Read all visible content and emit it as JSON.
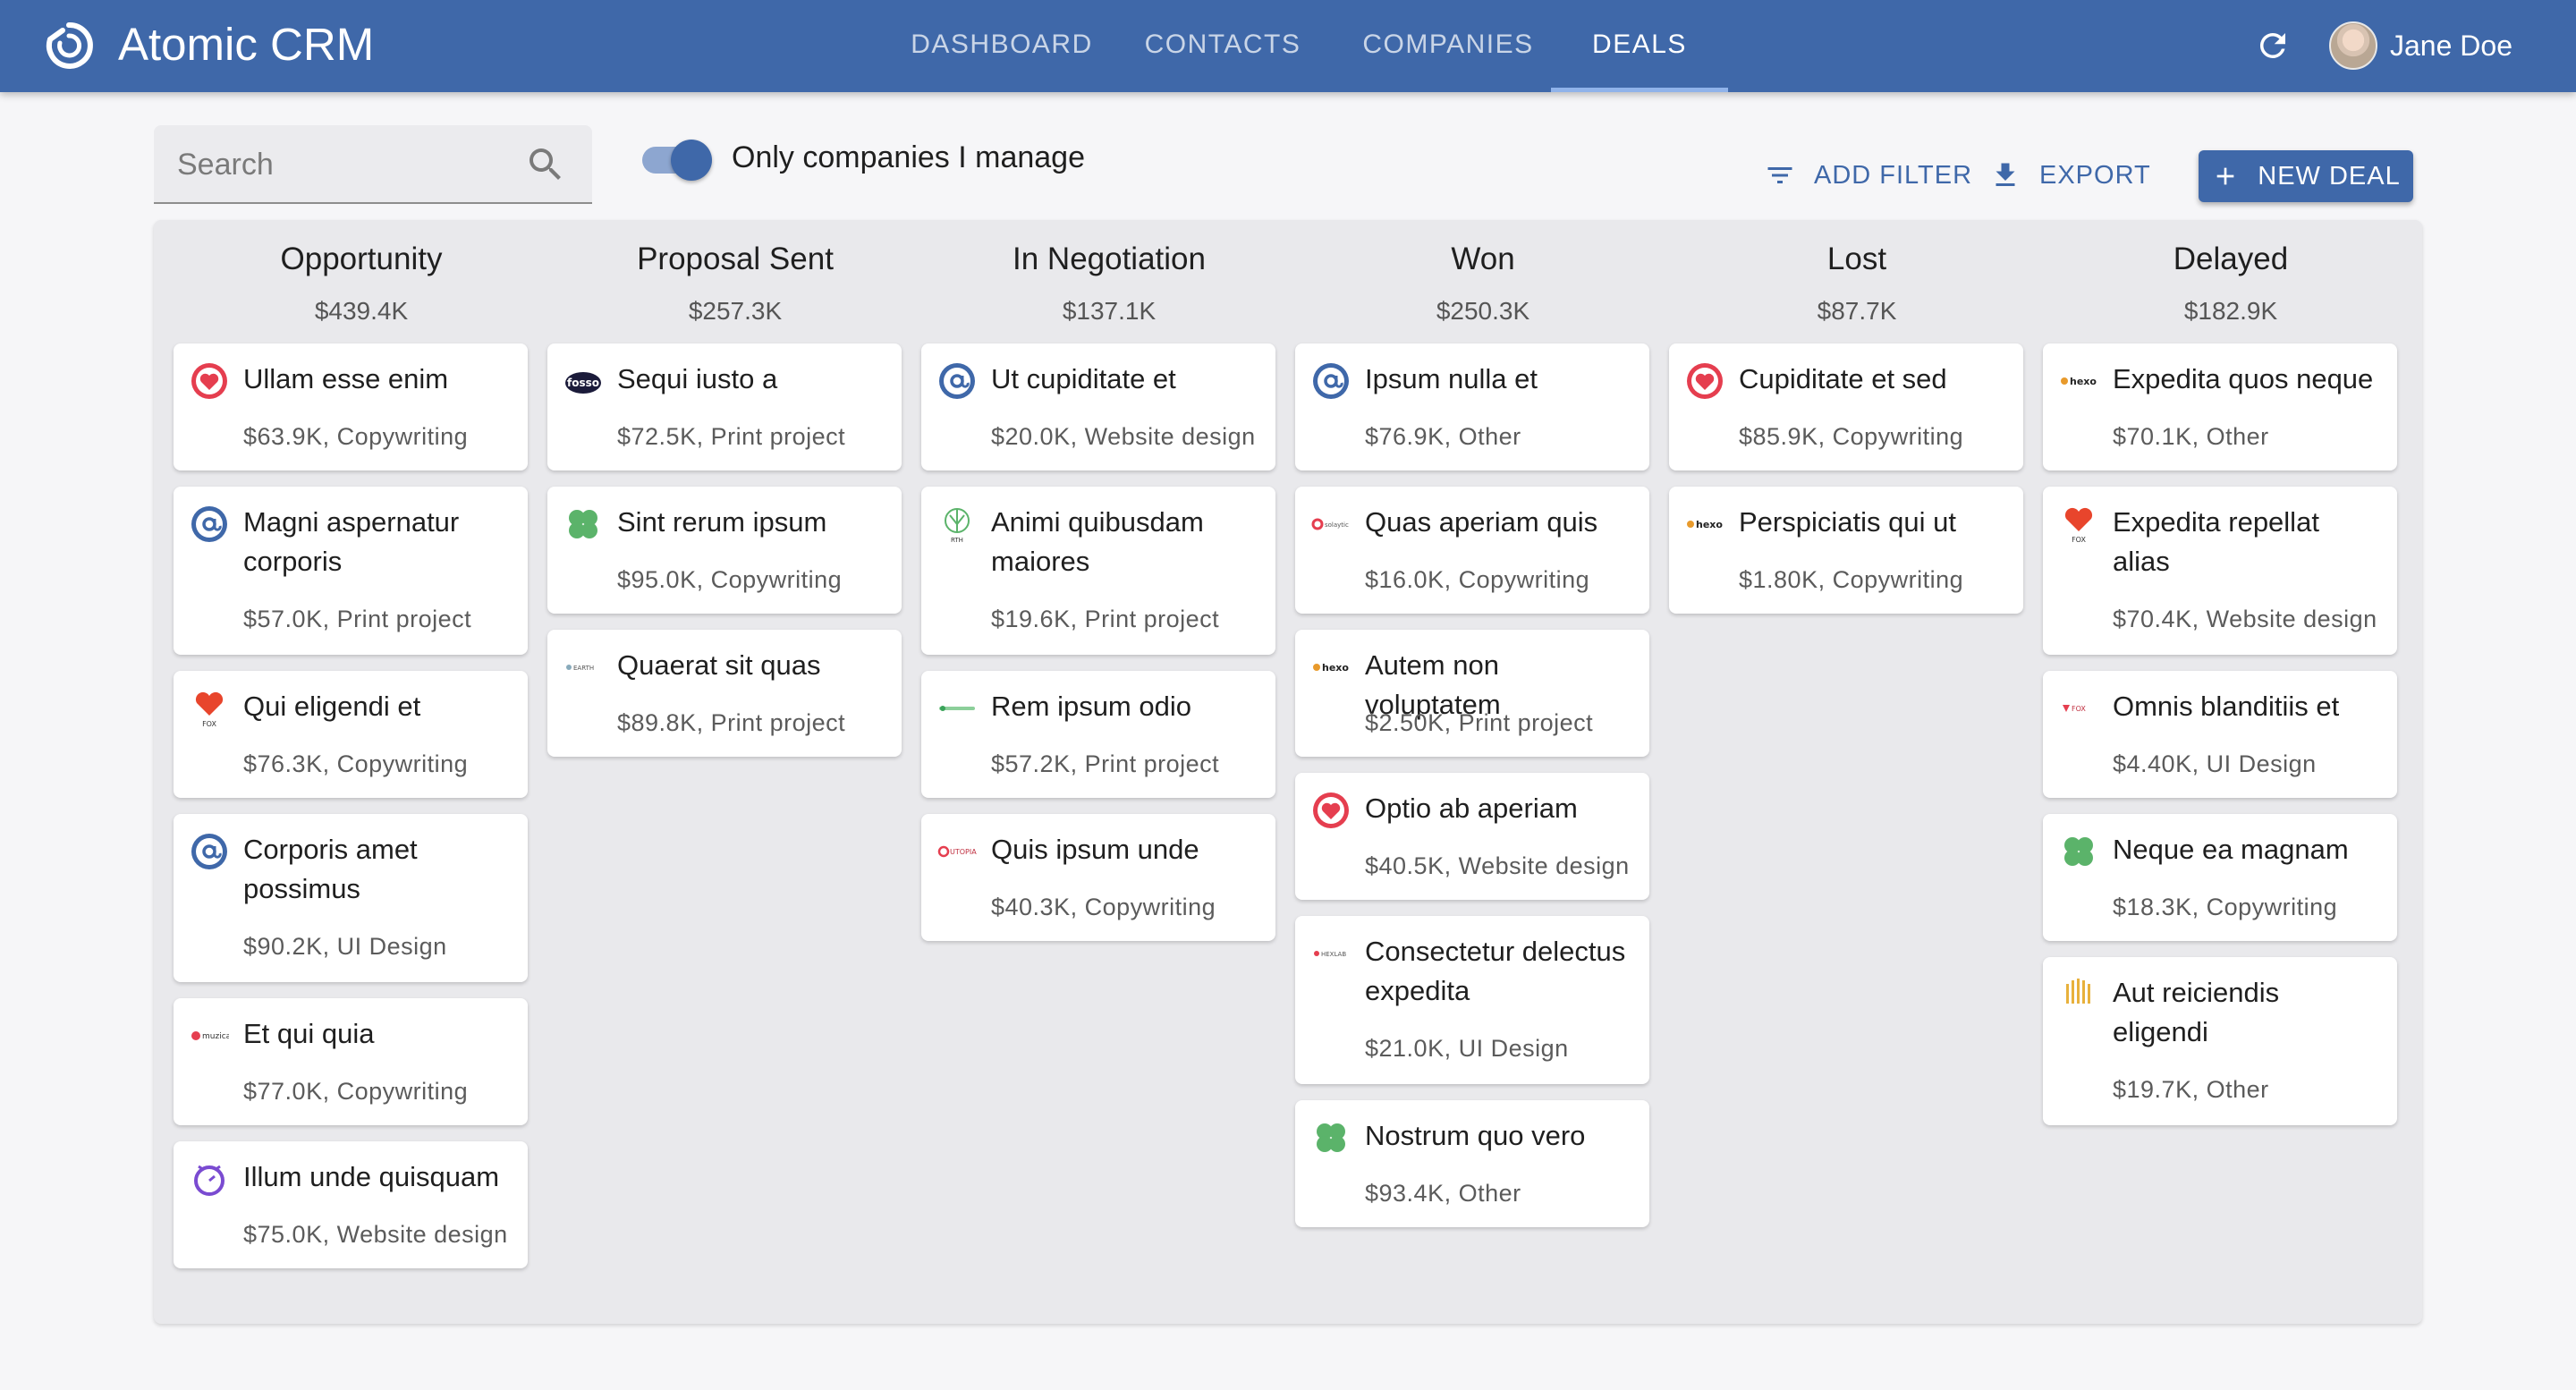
{
  "app": {
    "title": "Atomic CRM"
  },
  "nav": {
    "tabs": [
      {
        "label": "DASHBOARD",
        "active": false
      },
      {
        "label": "CONTACTS",
        "active": false
      },
      {
        "label": "COMPANIES",
        "active": false
      },
      {
        "label": "DEALS",
        "active": true
      }
    ]
  },
  "user": {
    "name": "Jane Doe"
  },
  "toolbar": {
    "search_placeholder": "Search",
    "toggle_label": "Only companies I manage",
    "toggle_on": true,
    "add_filter": "ADD FILTER",
    "export": "EXPORT",
    "new_deal": "NEW DEAL"
  },
  "colors": {
    "primary": "#3f68a9",
    "board_bg": "#e9e9ec"
  },
  "columns": [
    {
      "title": "Opportunity",
      "total": "$439.4K",
      "cards": [
        {
          "name": "Ullam esse enim",
          "meta": "$63.9K, Copywriting",
          "logo": "heart-logo-icon"
        },
        {
          "name": "Magni aspernatur corporis",
          "meta": "$57.0K, Print project",
          "logo": "at-logo-icon"
        },
        {
          "name": "Qui eligendi et",
          "meta": "$76.3K, Copywriting",
          "logo": "heart-fox-logo-icon"
        },
        {
          "name": "Corporis amet possimus",
          "meta": "$90.2K, UI Design",
          "logo": "at-logo-icon"
        },
        {
          "name": "Et qui quia",
          "meta": "$77.0K, Copywriting",
          "logo": "muzica-logo-icon"
        },
        {
          "name": "Illum unde quisquam",
          "meta": "$75.0K, Website design",
          "logo": "clock-logo-icon"
        }
      ]
    },
    {
      "title": "Proposal Sent",
      "total": "$257.3K",
      "cards": [
        {
          "name": "Sequi iusto a",
          "meta": "$72.5K, Print project",
          "logo": "fosso-logo-icon"
        },
        {
          "name": "Sint rerum ipsum",
          "meta": "$95.0K, Copywriting",
          "logo": "clover-logo-icon"
        },
        {
          "name": "Quaerat sit quas",
          "meta": "$89.8K, Print project",
          "logo": "earth-logo-icon"
        }
      ]
    },
    {
      "title": "In Negotiation",
      "total": "$137.1K",
      "cards": [
        {
          "name": "Ut cupiditate et",
          "meta": "$20.0K, Website design",
          "logo": "at-logo-icon"
        },
        {
          "name": "Animi quibusdam maiores",
          "meta": "$19.6K, Print project",
          "logo": "leaf-logo-icon"
        },
        {
          "name": "Rem ipsum odio",
          "meta": "$57.2K, Print project",
          "logo": "green-line-logo-icon"
        },
        {
          "name": "Quis ipsum unde",
          "meta": "$40.3K, Copywriting",
          "logo": "utopia-logo-icon"
        }
      ]
    },
    {
      "title": "Won",
      "total": "$250.3K",
      "cards": [
        {
          "name": "Ipsum nulla et",
          "meta": "$76.9K, Other",
          "logo": "at-logo-icon"
        },
        {
          "name": "Quas aperiam quis",
          "meta": "$16.0K, Copywriting",
          "logo": "red-dot-logo-icon"
        },
        {
          "name": "Autem non voluptatem",
          "meta": "$2.50K, Print project",
          "logo": "hexo-logo-icon"
        },
        {
          "name": "Optio ab aperiam",
          "meta": "$40.5K, Website design",
          "logo": "heart-logo-icon"
        },
        {
          "name": "Consectetur delectus expedita",
          "meta": "$21.0K, UI Design",
          "logo": "hexlab-logo-icon"
        },
        {
          "name": "Nostrum quo vero",
          "meta": "$93.4K, Other",
          "logo": "clover-logo-icon"
        }
      ]
    },
    {
      "title": "Lost",
      "total": "$87.7K",
      "cards": [
        {
          "name": "Cupiditate et sed",
          "meta": "$85.9K, Copywriting",
          "logo": "heart-logo-icon"
        },
        {
          "name": "Perspiciatis qui ut",
          "meta": "$1.80K, Copywriting",
          "logo": "hexo-logo-icon"
        }
      ]
    },
    {
      "title": "Delayed",
      "total": "$182.9K",
      "cards": [
        {
          "name": "Expedita quos neque",
          "meta": "$70.1K, Other",
          "logo": "hexo-logo-icon"
        },
        {
          "name": "Expedita repellat alias",
          "meta": "$70.4K, Website design",
          "logo": "heart-fox-logo-icon"
        },
        {
          "name": "Omnis blanditiis et",
          "meta": "$4.40K, UI Design",
          "logo": "fox-logo-icon"
        },
        {
          "name": "Neque ea magnam",
          "meta": "$18.3K, Copywriting",
          "logo": "clover-logo-icon"
        },
        {
          "name": "Aut reiciendis eligendi",
          "meta": "$19.7K, Other",
          "logo": "bars-logo-icon"
        }
      ]
    }
  ]
}
